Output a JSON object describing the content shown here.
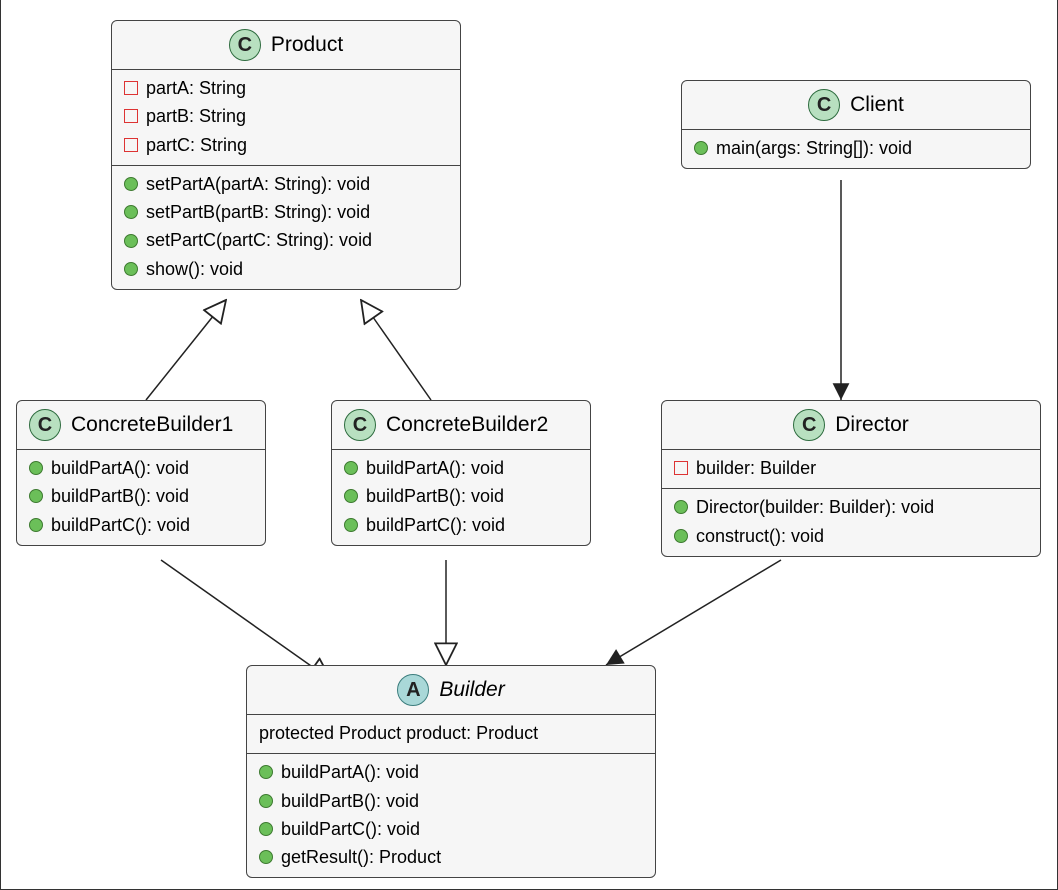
{
  "classes": {
    "product": {
      "stereotype": "C",
      "name": "Product",
      "abstract": false,
      "attributes": [
        {
          "vis": "private",
          "sig": "partA: String"
        },
        {
          "vis": "private",
          "sig": "partB: String"
        },
        {
          "vis": "private",
          "sig": "partC: String"
        }
      ],
      "methods": [
        {
          "vis": "public",
          "sig": "setPartA(partA: String): void"
        },
        {
          "vis": "public",
          "sig": "setPartB(partB: String): void"
        },
        {
          "vis": "public",
          "sig": "setPartC(partC: String): void"
        },
        {
          "vis": "public",
          "sig": "show(): void"
        }
      ]
    },
    "client": {
      "stereotype": "C",
      "name": "Client",
      "abstract": false,
      "attributes": [],
      "methods": [
        {
          "vis": "public",
          "sig": "main(args: String[]): void"
        }
      ]
    },
    "cb1": {
      "stereotype": "C",
      "name": "ConcreteBuilder1",
      "abstract": false,
      "attributes": [],
      "methods": [
        {
          "vis": "public",
          "sig": "buildPartA(): void"
        },
        {
          "vis": "public",
          "sig": "buildPartB(): void"
        },
        {
          "vis": "public",
          "sig": "buildPartC(): void"
        }
      ]
    },
    "cb2": {
      "stereotype": "C",
      "name": "ConcreteBuilder2",
      "abstract": false,
      "attributes": [],
      "methods": [
        {
          "vis": "public",
          "sig": "buildPartA(): void"
        },
        {
          "vis": "public",
          "sig": "buildPartB(): void"
        },
        {
          "vis": "public",
          "sig": "buildPartC(): void"
        }
      ]
    },
    "director": {
      "stereotype": "C",
      "name": "Director",
      "abstract": false,
      "attributes": [
        {
          "vis": "private",
          "sig": "builder: Builder"
        }
      ],
      "methods": [
        {
          "vis": "public",
          "sig": "Director(builder: Builder): void"
        },
        {
          "vis": "public",
          "sig": "construct(): void"
        }
      ]
    },
    "builder": {
      "stereotype": "A",
      "name": "Builder",
      "abstract": true,
      "attributes": [
        {
          "vis": "none",
          "sig": "protected Product product: Product"
        }
      ],
      "methods": [
        {
          "vis": "public",
          "sig": "buildPartA(): void"
        },
        {
          "vis": "public",
          "sig": "buildPartB(): void"
        },
        {
          "vis": "public",
          "sig": "buildPartC(): void"
        },
        {
          "vis": "public",
          "sig": "getResult(): Product"
        }
      ]
    }
  },
  "relationships": [
    {
      "from": "cb1",
      "to": "product",
      "type": "generalization"
    },
    {
      "from": "cb2",
      "to": "product",
      "type": "generalization"
    },
    {
      "from": "cb1",
      "to": "builder",
      "type": "generalization"
    },
    {
      "from": "cb2",
      "to": "builder",
      "type": "generalization"
    },
    {
      "from": "client",
      "to": "director",
      "type": "association"
    },
    {
      "from": "director",
      "to": "builder",
      "type": "association"
    }
  ]
}
